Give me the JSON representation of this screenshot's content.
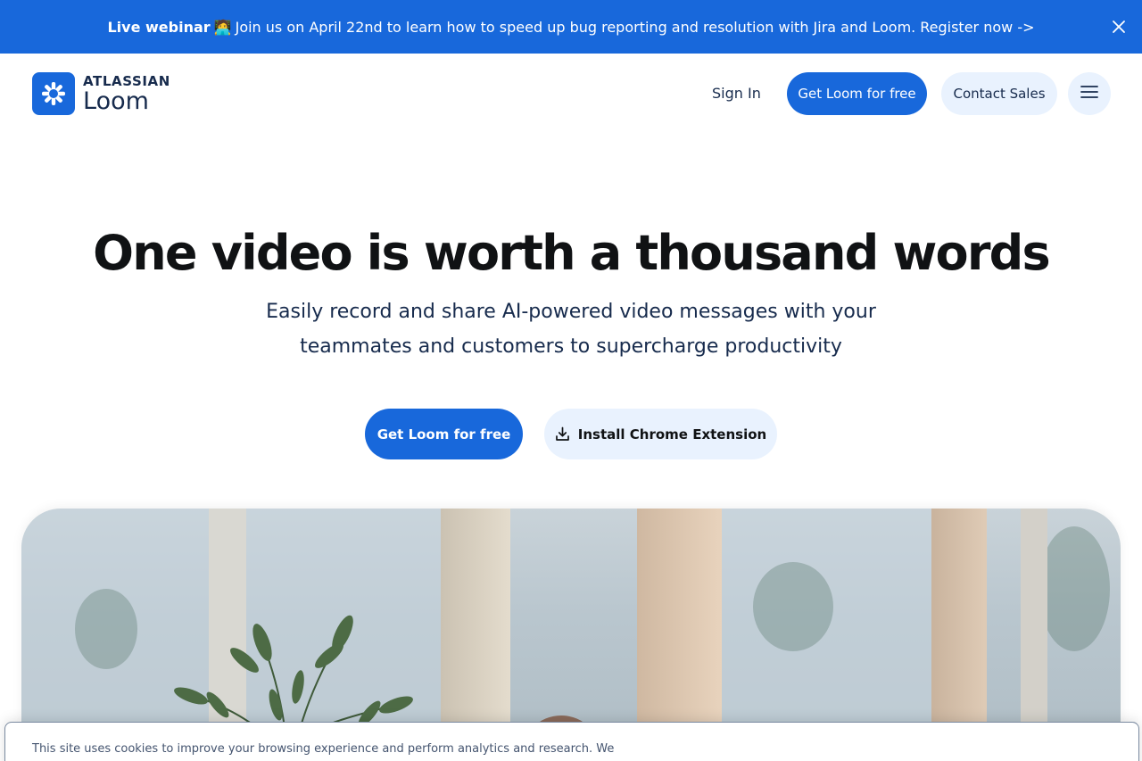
{
  "banner": {
    "bold_label": "Live webinar",
    "emoji": "🧑‍💻",
    "message": "Join us on April 22nd to learn how to speed up bug reporting and resolution with Jira and Loom.",
    "link_label": "Register now ->",
    "close_icon": "close-icon"
  },
  "nav": {
    "logo_brand": "ATLASSIAN",
    "logo_product": "Loom",
    "sign_in_label": "Sign In",
    "get_loom_label": "Get Loom for free",
    "contact_sales_label": "Contact Sales",
    "menu_icon": "hamburger-icon"
  },
  "hero": {
    "title": "One video is worth a thousand words",
    "subtitle": "Easily record and share AI-powered video messages with your teammates and customers to supercharge productivity",
    "cta_primary_label": "Get Loom for free",
    "cta_secondary_label": "Install Chrome Extension",
    "cta_secondary_icon": "download-icon"
  },
  "cookie": {
    "text": "This site uses cookies to improve your browsing experience and perform analytics and research. We may also"
  },
  "colors": {
    "brand_blue": "#1868db",
    "light_blue": "#e9f2fe",
    "text_dark": "#101214"
  }
}
